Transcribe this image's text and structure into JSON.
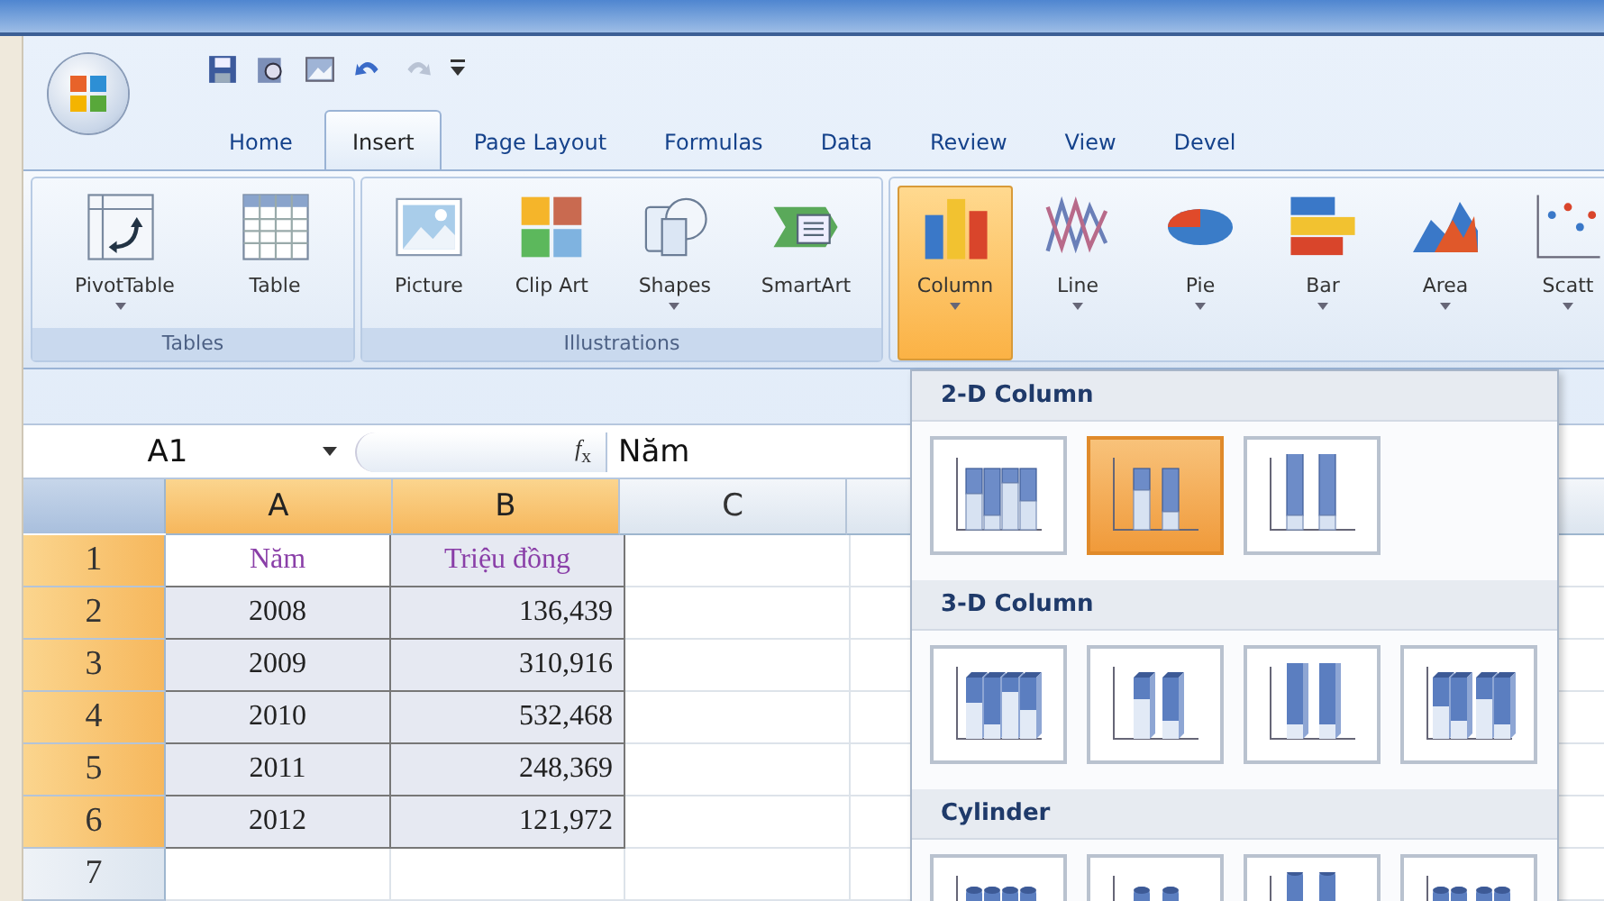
{
  "tabs": [
    {
      "label": "Home",
      "selected": false
    },
    {
      "label": "Insert",
      "selected": true
    },
    {
      "label": "Page Layout",
      "selected": false
    },
    {
      "label": "Formulas",
      "selected": false
    },
    {
      "label": "Data",
      "selected": false
    },
    {
      "label": "Review",
      "selected": false
    },
    {
      "label": "View",
      "selected": false
    },
    {
      "label": "Devel",
      "selected": false
    }
  ],
  "ribbon": {
    "groups": [
      {
        "label": "Tables",
        "buttons": [
          {
            "label": "PivotTable",
            "has_menu": true,
            "selected": false
          },
          {
            "label": "Table",
            "has_menu": false,
            "selected": false
          }
        ]
      },
      {
        "label": "Illustrations",
        "buttons": [
          {
            "label": "Picture",
            "has_menu": false,
            "selected": false
          },
          {
            "label": "Clip Art",
            "has_menu": false,
            "selected": false
          },
          {
            "label": "Shapes",
            "has_menu": true,
            "selected": false
          },
          {
            "label": "SmartArt",
            "has_menu": false,
            "selected": false
          }
        ]
      },
      {
        "buttons": [
          {
            "label": "Column",
            "has_menu": true,
            "selected": true
          },
          {
            "label": "Line",
            "has_menu": true,
            "selected": false
          },
          {
            "label": "Pie",
            "has_menu": true,
            "selected": false
          },
          {
            "label": "Bar",
            "has_menu": true,
            "selected": false
          },
          {
            "label": "Area",
            "has_menu": true,
            "selected": false
          },
          {
            "label": "Scatt",
            "has_menu": true,
            "selected": false
          }
        ]
      }
    ]
  },
  "formula_bar": {
    "name_box": "A1",
    "fx_label": "*f*$_{x}$",
    "content": "Năm"
  },
  "sheet": {
    "columns": [
      {
        "label": "A",
        "selected": true
      },
      {
        "label": "B",
        "selected": true
      },
      {
        "label": "C",
        "selected": false
      }
    ],
    "rows": [
      {
        "number": "1",
        "selected": true,
        "kind": "header",
        "cells": [
          {
            "text": "Năm",
            "active": true
          },
          {
            "text": "Triệu đồng",
            "active": false
          }
        ]
      },
      {
        "number": "2",
        "selected": true,
        "kind": "data",
        "cells": [
          {
            "text": "2008",
            "active": false
          },
          {
            "text": "136,439",
            "active": false
          }
        ]
      },
      {
        "number": "3",
        "selected": true,
        "kind": "data",
        "cells": [
          {
            "text": "2009",
            "active": false
          },
          {
            "text": "310,916",
            "active": false
          }
        ]
      },
      {
        "number": "4",
        "selected": true,
        "kind": "data",
        "cells": [
          {
            "text": "2010",
            "active": false
          },
          {
            "text": "532,468",
            "active": false
          }
        ]
      },
      {
        "number": "5",
        "selected": true,
        "kind": "data",
        "cells": [
          {
            "text": "2011",
            "active": false
          },
          {
            "text": "248,369",
            "active": false
          }
        ]
      },
      {
        "number": "6",
        "selected": true,
        "kind": "data",
        "cells": [
          {
            "text": "2012",
            "active": false
          },
          {
            "text": "121,972",
            "active": false
          }
        ]
      },
      {
        "number": "7",
        "selected": false,
        "kind": "data",
        "cells": []
      }
    ]
  },
  "chart_menu": {
    "sections": [
      {
        "title": "2-D Column",
        "kind": "flat",
        "items": [
          {
            "kind": "clustered",
            "selected": false
          },
          {
            "kind": "stacked",
            "selected": true
          },
          {
            "kind": "percent",
            "selected": false
          }
        ]
      },
      {
        "title": "3-D Column",
        "kind": "solid",
        "items": [
          {
            "kind": "clustered",
            "selected": false
          },
          {
            "kind": "stacked",
            "selected": false
          },
          {
            "kind": "percent",
            "selected": false
          },
          {
            "kind": "deep",
            "selected": false
          }
        ]
      },
      {
        "title": "Cylinder",
        "kind": "cylinder",
        "items": [
          {
            "kind": "clustered",
            "selected": false
          },
          {
            "kind": "stacked",
            "selected": false
          },
          {
            "kind": "percent",
            "selected": false
          },
          {
            "kind": "deep",
            "selected": false
          }
        ]
      }
    ]
  }
}
